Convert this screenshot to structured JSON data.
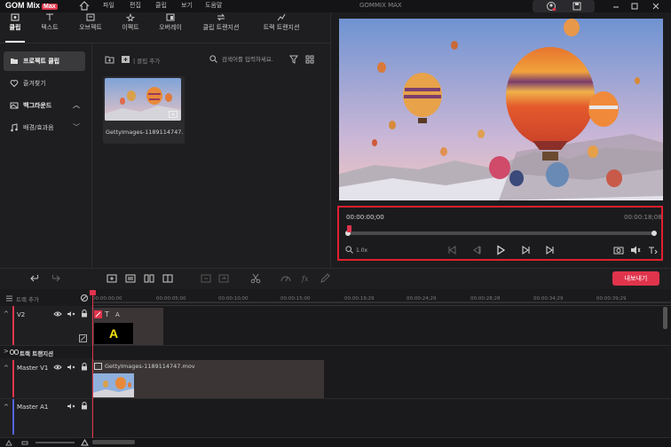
{
  "app": {
    "logo": "GOM Mix",
    "logo_badge": "Max",
    "title": "GOMMIX MAX"
  },
  "menu": [
    "파일",
    "편집",
    "클립",
    "보기",
    "도움말"
  ],
  "tabs": [
    {
      "label": "클립",
      "icon": "clip-icon"
    },
    {
      "label": "텍스트",
      "icon": "text-icon"
    },
    {
      "label": "오브젝트",
      "icon": "object-icon"
    },
    {
      "label": "이펙트",
      "icon": "effect-icon"
    },
    {
      "label": "오버레이",
      "icon": "overlay-icon"
    },
    {
      "label": "클립 트랜지션",
      "icon": "clip-transition-icon"
    },
    {
      "label": "트랙 트랜지션",
      "icon": "track-transition-icon"
    }
  ],
  "sidebar": [
    {
      "label": "프로젝트 클립",
      "icon": "folder-icon",
      "active": true
    },
    {
      "label": "즐겨찾기",
      "icon": "heart-icon"
    },
    {
      "label": "백그라운드",
      "icon": "background-icon",
      "chevron": "up"
    },
    {
      "label": "배경/효과음",
      "icon": "music-icon",
      "chevron": "down"
    }
  ],
  "clip_panel": {
    "add_label": "클립 추가",
    "search_placeholder": "검색어를 입력하세요."
  },
  "media": {
    "name": "GettyImages-1189114747..."
  },
  "player": {
    "current_time": "00:00:00;00",
    "total_time": "00:00:18;08",
    "zoom": "1.0x"
  },
  "export_label": "내보내기",
  "timeline": {
    "add_track": "트랙 추가",
    "ticks": [
      "00:00:00;00",
      "00:00:05;00",
      "00:00:10;00",
      "00:00:15;00",
      "00:00:19;29",
      "00:00:24;29",
      "00:00:28;28",
      "00:00:34;29",
      "00:00:39;29",
      "00:00:44;28"
    ],
    "tracks": {
      "v2": "V2",
      "transition": "트랙 트랜지션",
      "v1": "Master V1",
      "a1": "Master A1"
    },
    "text_clip": "A",
    "text_clip_icon_label": "A",
    "video_clip": "GettyImages-1189114747.mov"
  },
  "colors": {
    "accent": "#e0344c",
    "panel": "#1e1e20",
    "highlight_border": "#e02030"
  }
}
